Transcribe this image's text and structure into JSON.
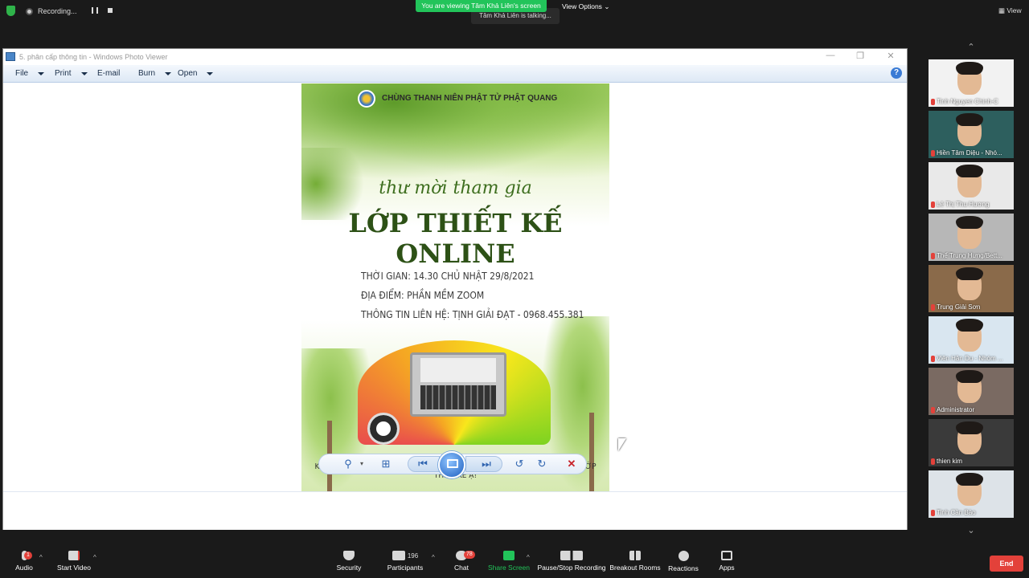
{
  "zoom_top": {
    "recording_label": "Recording...",
    "viewing_banner": "You are viewing Tâm Khả Liên's screen",
    "talking": "Tâm Khả Liên is talking...",
    "view_options": "View Options",
    "view_label": "View"
  },
  "viewer": {
    "title": "5. phân cấp thông tin - Windows Photo Viewer",
    "menu": [
      {
        "label": "File"
      },
      {
        "label": "Print"
      },
      {
        "label": "E-mail"
      },
      {
        "label": "Burn"
      },
      {
        "label": "Open"
      }
    ],
    "help": "?"
  },
  "poster": {
    "org": "CHÙNG THANH NIÊN PHẬT TỬ PHẬT QUANG",
    "invite": "thư mời tham gia",
    "class_title": "LỚP THIẾT KẾ ONLINE",
    "time": "THỜI GIAN: 14.30 CHỦ NHẬT 29/8/2021",
    "place": "ĐỊA ĐIỂM: PHẦN MỀM ZOOM",
    "contact": "THÔNG TIN LIÊN HỆ: TỊNH GIẢI ĐẠT - 0968.455.381",
    "footer": "KÍNH MỜI HUYNH ĐỆ, CÁC BẠN THANH NIÊN, SINH VIÊN CÙNG THAM GIA LỚP THIẾT KẾ Ạ!"
  },
  "participants": [
    {
      "name": "Tinh Nguyen Chinh-C",
      "bg": "#f2f2f2"
    },
    {
      "name": "Hiền Tâm Diệu - Nhó...",
      "bg": "#2d5f5e"
    },
    {
      "name": "Lê Thị Thu Hương",
      "bg": "#e9e9e9"
    },
    {
      "name": "Thể Trung Hưng/Bett...",
      "bg": "#b7b7b7"
    },
    {
      "name": "Trung Giải Sơn",
      "bg": "#8a6a4a"
    },
    {
      "name": "Viên Hân Du - Nhóm ...",
      "bg": "#d9e6f0"
    },
    {
      "name": "Administrator",
      "bg": "#7a6a62"
    },
    {
      "name": "thien kim",
      "bg": "#3a3a3a"
    },
    {
      "name": "Tinh Cần Bảo",
      "bg": "#dde3e8"
    }
  ],
  "zoom_toolbar": {
    "audio": "Audio",
    "start_video": "Start Video",
    "security": "Security",
    "participants": "Participants",
    "participants_count": "196",
    "chat": "Chat",
    "chat_badge": "78",
    "share_screen": "Share Screen",
    "pause_recording": "Pause/Stop Recording",
    "breakout_rooms": "Breakout Rooms",
    "reactions": "Reactions",
    "apps": "Apps",
    "end": "End",
    "audio_badge": "1"
  }
}
